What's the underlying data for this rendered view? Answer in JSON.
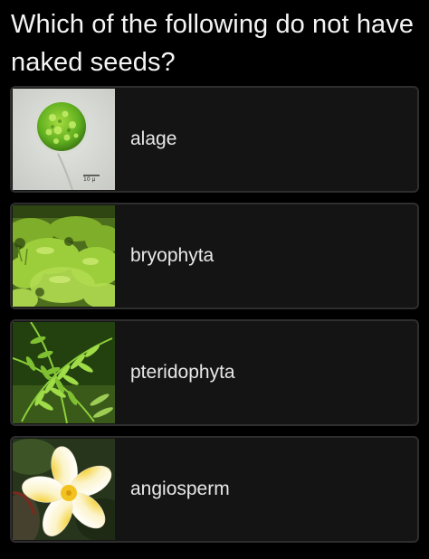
{
  "question": {
    "text": "Which of the following do not have naked seeds?"
  },
  "options": [
    {
      "label": "alage",
      "image": "algae-cell-micrograph",
      "scale_label": "10 µ"
    },
    {
      "label": "bryophyta",
      "image": "moss-landscape-photo"
    },
    {
      "label": "pteridophyta",
      "image": "fern-fronds-photo"
    },
    {
      "label": "angiosperm",
      "image": "plumeria-flower-photo"
    }
  ],
  "colors": {
    "background": "#000000",
    "card": "#141414",
    "card_border": "#2e2e2e",
    "text": "#f2f2f2"
  }
}
